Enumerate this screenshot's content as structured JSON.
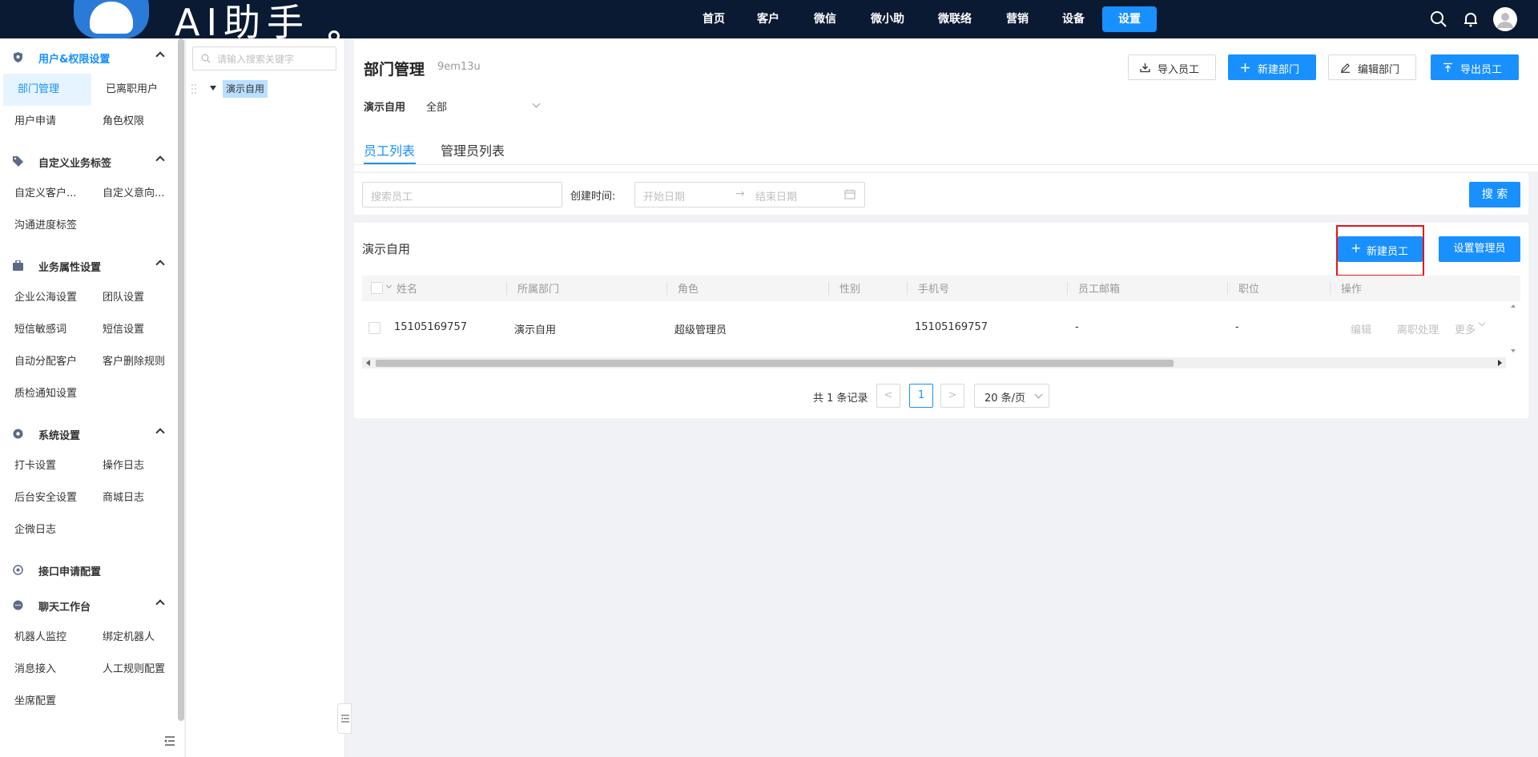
{
  "brand": {
    "title": "AI助手"
  },
  "topnav": [
    {
      "label": "首页",
      "active": false
    },
    {
      "label": "客户",
      "active": false
    },
    {
      "label": "微信",
      "active": false
    },
    {
      "label": "微小助",
      "active": false
    },
    {
      "label": "微联络",
      "active": false
    },
    {
      "label": "营销",
      "active": false
    },
    {
      "label": "设备",
      "active": false
    },
    {
      "label": "设置",
      "active": true
    }
  ],
  "sidebar": {
    "sections": [
      {
        "title": "用户&权限设置",
        "items": [
          "部门管理",
          "已离职用户",
          "用户申请",
          "角色权限"
        ]
      },
      {
        "title": "自定义业务标签",
        "items": [
          "自定义客户...",
          "自定义意向...",
          "沟通进度标签"
        ]
      },
      {
        "title": "业务属性设置",
        "items": [
          "企业公海设置",
          "团队设置",
          "短信敏感词",
          "短信设置",
          "自动分配客户",
          "客户删除规则",
          "质检通知设置"
        ]
      },
      {
        "title": "系统设置",
        "items": [
          "打卡设置",
          "操作日志",
          "后台安全设置",
          "商城日志",
          "企微日志"
        ]
      },
      {
        "title": "接口申请配置",
        "items": []
      },
      {
        "title": "聊天工作台",
        "items": [
          "机器人监控",
          "绑定机器人",
          "消息接入",
          "人工规则配置",
          "坐席配置"
        ]
      }
    ],
    "active_item": "部门管理"
  },
  "tree": {
    "search_placeholder": "请输入搜索关键字",
    "root": "演示自用"
  },
  "main": {
    "title": "部门管理",
    "code": "9em13u",
    "buttons": {
      "import": "导入员工",
      "new_dept": "新建部门",
      "edit_dept": "编辑部门",
      "export": "导出员工"
    },
    "filter": {
      "label": "演示自用",
      "value": "全部"
    },
    "tabs": [
      "员工列表",
      "管理员列表"
    ],
    "search": {
      "employee_placeholder": "搜索员工",
      "created_label": "创建时间:",
      "start_placeholder": "开始日期",
      "end_placeholder": "结束日期",
      "arrow": "→",
      "button": "搜 索"
    },
    "list": {
      "title": "演示自用",
      "new_employee": "新建员工",
      "set_admin": "设置管理员",
      "columns": [
        "姓名",
        "所属部门",
        "角色",
        "性别",
        "手机号",
        "员工邮箱",
        "职位",
        "操作"
      ],
      "rows": [
        {
          "name": "15105169757",
          "dept": "演示自用",
          "role": "超级管理员",
          "gender": "",
          "phone": "15105169757",
          "email": "-",
          "position": "-",
          "actions": [
            "编辑",
            "离职处理",
            "更多"
          ]
        }
      ]
    },
    "pagination": {
      "total_text": "共 1 条记录",
      "prev": "<",
      "page": "1",
      "next": ">",
      "page_size": "20 条/页"
    }
  },
  "colors": {
    "topbar": "#0b1a33",
    "primary": "#1890ff",
    "highlight": "#e8121a"
  }
}
